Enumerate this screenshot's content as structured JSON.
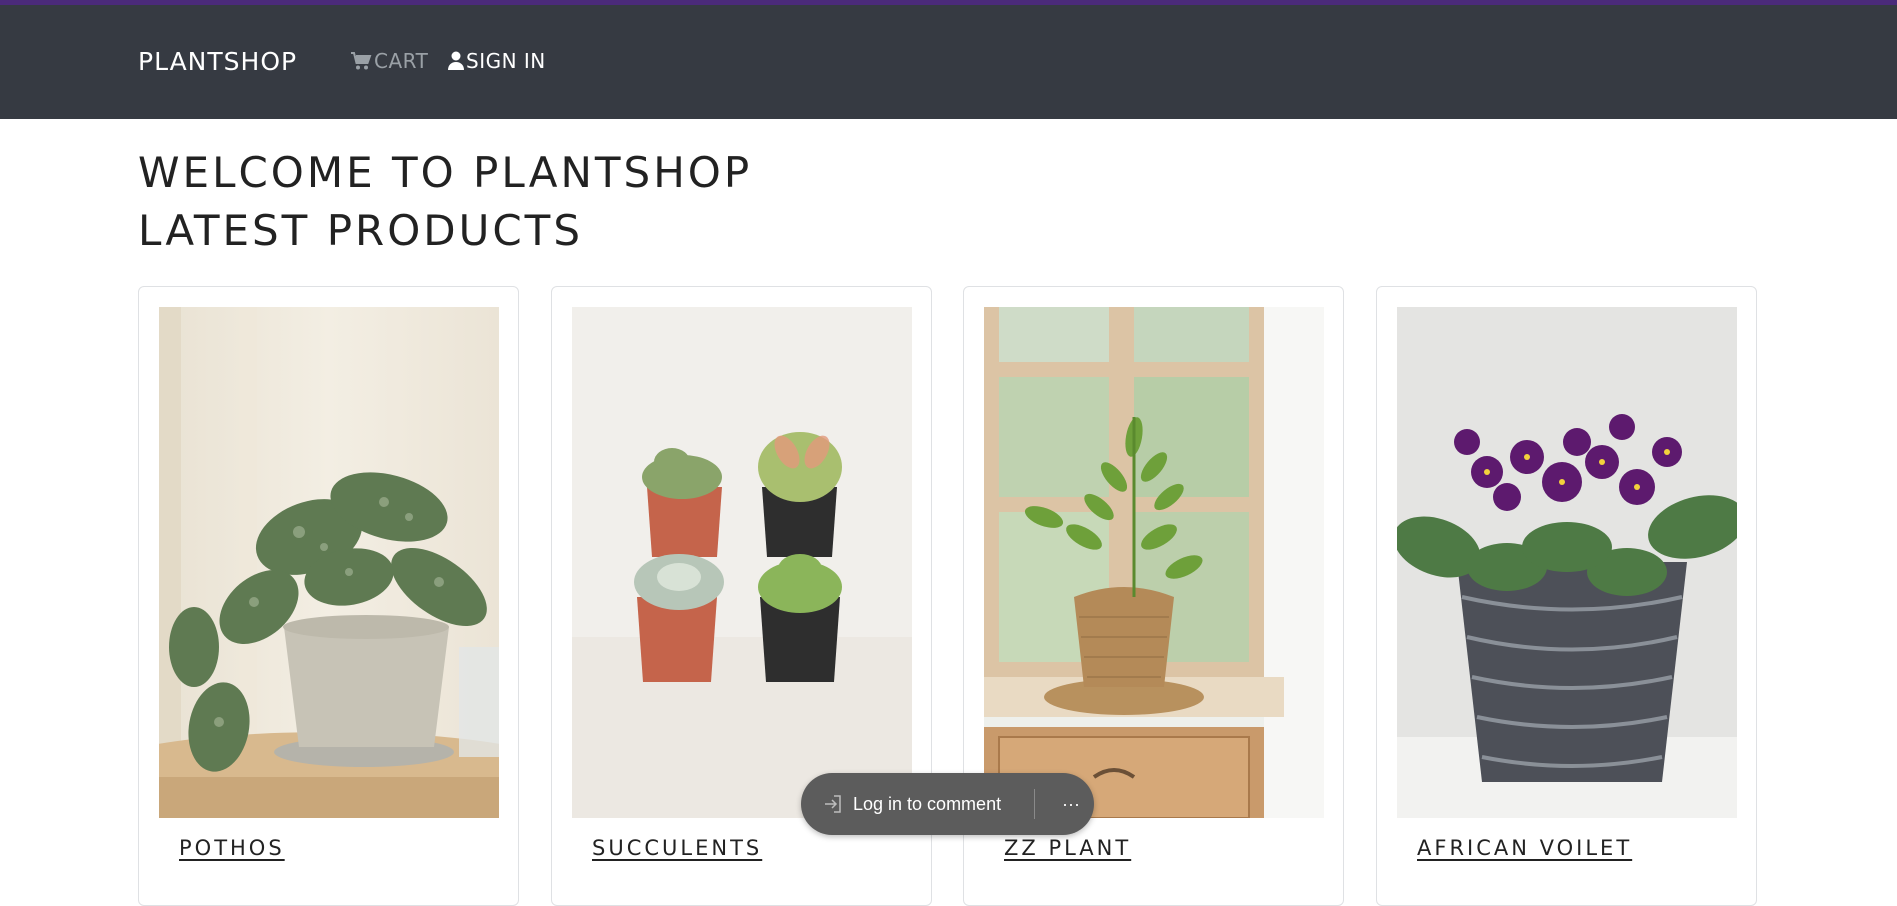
{
  "nav": {
    "brand": "PLANTSHOP",
    "cart_label": "CART",
    "signin_label": "SIGN IN",
    "cart_icon": "cart-icon",
    "signin_icon": "user-icon"
  },
  "headings": {
    "welcome": "WELCOME TO PLANTSHOP",
    "latest": "LATEST PRODUCTS"
  },
  "products": [
    {
      "name": "POTHOS"
    },
    {
      "name": "SUCCULENTS"
    },
    {
      "name": "ZZ PLANT"
    },
    {
      "name": "AFRICAN VOILET"
    }
  ],
  "comment_bar": {
    "login_label": "Log in to comment",
    "login_icon": "sign-in-icon",
    "more_icon": "more-icon",
    "more_glyph": "···"
  },
  "colors": {
    "accent": "#4b2a7a",
    "navbar": "#363a42",
    "comment_bar": "#5c5c5c"
  }
}
